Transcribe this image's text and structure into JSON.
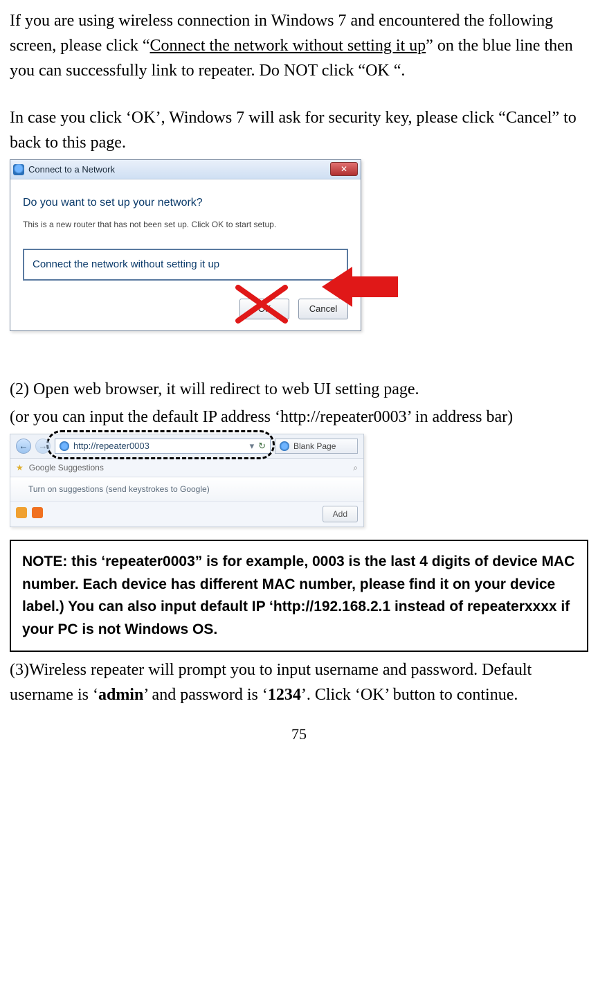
{
  "para1_a": "If you are using wireless connection in Windows 7 and encountered the following screen, please click “",
  "para1_link": "Connect the network without setting it up",
  "para1_b": "” on the blue line then you can successfully link to repeater. Do NOT click “OK “.",
  "para2": "In case you click ‘OK’, Windows 7 will ask for security key, please click “Cancel” to back to this page.",
  "dialog": {
    "title": "Connect to a Network",
    "heading": "Do you want to set up your network?",
    "sub": "This is a new router that has not been set up. Click OK to start setup.",
    "connect_link": "Connect the network without setting it up",
    "ok": "OK",
    "cancel": "Cancel",
    "close_glyph": "✕"
  },
  "para3": "(2) Open web browser, it will redirect to web UI setting page.",
  "para4": "(or you can input the default IP address ‘http://repeater0003’ in address bar)",
  "browser": {
    "url": "http://repeater0003",
    "tab": "Blank Page",
    "suggestions_label": "Google Suggestions",
    "suggestion_line": "Turn on suggestions (send keystrokes to Google)",
    "add": "Add",
    "back_glyph": "←",
    "fwd_glyph": "→",
    "dd_glyph": "▾",
    "refresh_glyph": "↻",
    "search_glyph": "⌕",
    "star_glyph": "★"
  },
  "note": "NOTE: this ‘repeater0003” is for example, 0003 is the last 4 digits of device MAC number. Each device has different MAC number, please find it on your device label.) You can also input default IP ‘http://192.168.2.1 instead of repeaterxxxx if your PC is not Windows OS.",
  "para5_a": "(3)Wireless repeater will prompt you to input username and password. Default username is ‘",
  "para5_user": "admin",
  "para5_b": "’ and password is ‘",
  "para5_pass": "1234",
  "para5_c": "’. Click ‘OK’ button to continue.",
  "page_number": "75"
}
